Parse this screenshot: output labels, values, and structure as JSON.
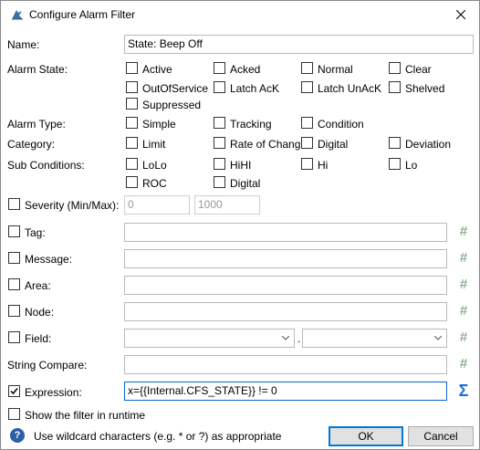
{
  "window": {
    "title": "Configure Alarm Filter"
  },
  "name": {
    "label": "Name:",
    "value": "State: Beep Off"
  },
  "alarm_state": {
    "label": "Alarm State:",
    "options": [
      {
        "label": "Active",
        "checked": false
      },
      {
        "label": "Acked",
        "checked": false
      },
      {
        "label": "Normal",
        "checked": false
      },
      {
        "label": "Clear",
        "checked": false
      },
      {
        "label": "OutOfService",
        "checked": false
      },
      {
        "label": "Latch AcK",
        "checked": false
      },
      {
        "label": "Latch UnAcK",
        "checked": false
      },
      {
        "label": "Shelved",
        "checked": false
      },
      {
        "label": "Suppressed",
        "checked": false
      }
    ]
  },
  "alarm_type": {
    "label": "Alarm Type:",
    "options": [
      {
        "label": "Simple",
        "checked": false
      },
      {
        "label": "Tracking",
        "checked": false
      },
      {
        "label": "Condition",
        "checked": false
      }
    ]
  },
  "category": {
    "label": "Category:",
    "options": [
      {
        "label": "Limit",
        "checked": false
      },
      {
        "label": "Rate of Chang",
        "checked": false
      },
      {
        "label": "Digital",
        "checked": false
      },
      {
        "label": "Deviation",
        "checked": false
      }
    ]
  },
  "sub_conditions": {
    "label": "Sub Conditions:",
    "options": [
      {
        "label": "LoLo",
        "checked": false
      },
      {
        "label": "HiHI",
        "checked": false
      },
      {
        "label": "Hi",
        "checked": false
      },
      {
        "label": "Lo",
        "checked": false
      },
      {
        "label": "ROC",
        "checked": false
      },
      {
        "label": "Digital",
        "checked": false
      }
    ]
  },
  "severity": {
    "label": "Severity (Min/Max):",
    "checked": false,
    "min_placeholder": "0",
    "max_placeholder": "1000"
  },
  "tag": {
    "label": "Tag:",
    "checked": false,
    "value": ""
  },
  "message": {
    "label": "Message:",
    "checked": false,
    "value": ""
  },
  "area": {
    "label": "Area:",
    "checked": false,
    "value": ""
  },
  "node": {
    "label": "Node:",
    "checked": false,
    "value": ""
  },
  "field": {
    "label": "Field:",
    "checked": false,
    "separator": "."
  },
  "string_compare": {
    "label": "String Compare:",
    "value": ""
  },
  "expression": {
    "label": "Expression:",
    "checked": true,
    "value": "x={{Internal.CFS_STATE}} != 0"
  },
  "show_in_runtime": {
    "label": "Show the filter in runtime",
    "checked": false
  },
  "footer": {
    "hint": "Use wildcard characters (e.g. * or ?) as appropriate",
    "ok_label": "OK",
    "cancel_label": "Cancel"
  },
  "icons": {
    "hash": "#",
    "sigma": "Σ",
    "help": "?",
    "check": "✓"
  },
  "colors": {
    "hash_icon": "#8db28d",
    "sigma_icon": "#1f6fd1",
    "help_icon": "#2b5fa7",
    "default_button_border": "#0078d7"
  }
}
